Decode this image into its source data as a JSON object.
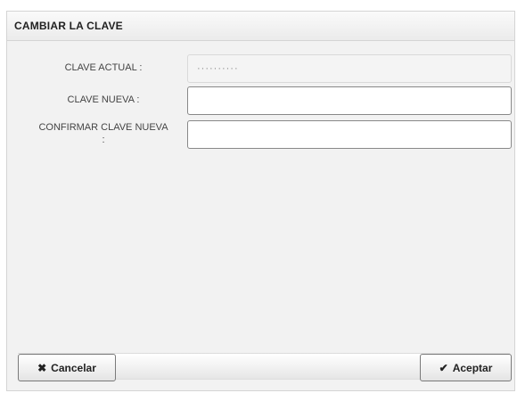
{
  "dialog": {
    "title": "CAMBIAR LA CLAVE"
  },
  "form": {
    "current_password": {
      "label": "CLAVE ACTUAL :",
      "value": "··········"
    },
    "new_password": {
      "label": "CLAVE NUEVA :",
      "value": ""
    },
    "confirm_password": {
      "label_line1": "CONFIRMAR CLAVE NUEVA",
      "label_line2": ":",
      "value": ""
    }
  },
  "footer": {
    "cancel_label": "Cancelar",
    "cancel_icon": "close-icon",
    "accept_label": "Aceptar",
    "accept_icon": "check-icon"
  },
  "colors": {
    "panel_background": "#f2f2f2",
    "header_background": "#ebebeb",
    "input_border": "#888888"
  }
}
